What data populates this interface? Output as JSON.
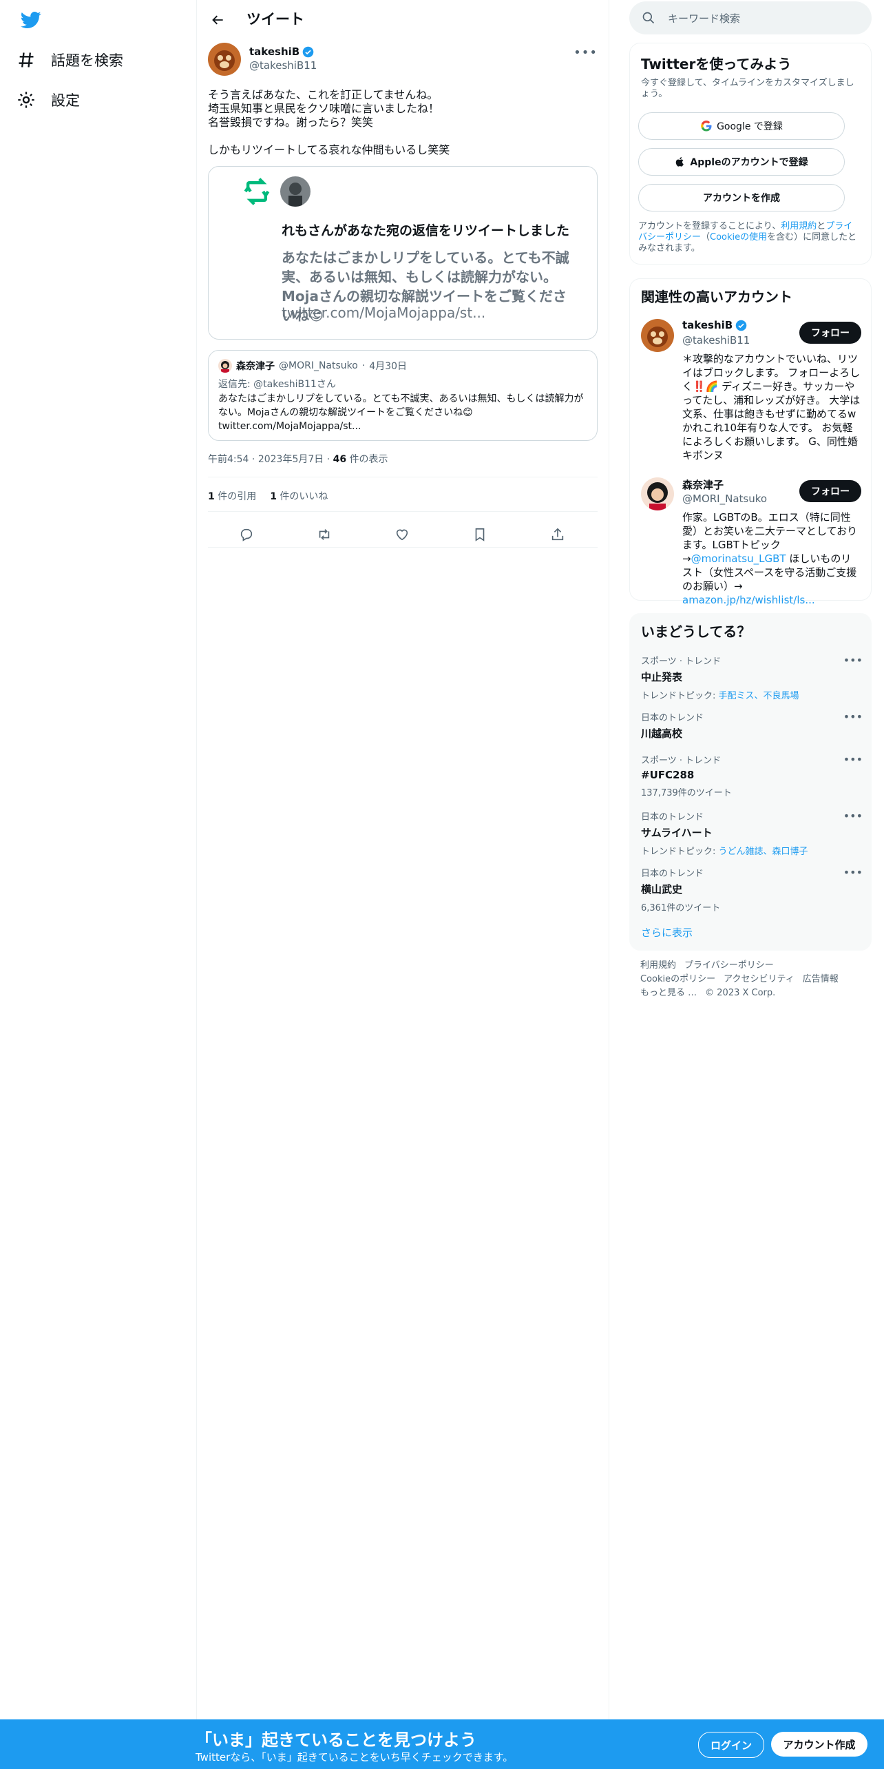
{
  "nav": {
    "explore_label": "話題を検索",
    "settings_label": "設定"
  },
  "header": {
    "title": "ツイート"
  },
  "tweet": {
    "author_name": "takeshiB",
    "author_handle": "@takeshiB11",
    "text": "そう言えばあなた、これを訂正してませんね。\n埼玉県知事と県民をクソ味噌に言いましたね！\n名誉毀損ですね。謝ったら？笑笑\n\nしかもリツイートしてる哀れな仲間もいるし笑笑",
    "card": {
      "heading": "れもさんがあなた宛の返信をリツイートしました",
      "body": "あなたはごまかしリプをしている。とても不誠実、あるいは無知、もしくは読解力がない。Mojaさんの親切な解説ツイートをご覧くださいね😊",
      "link": "twitter.com/MojaMojappa/st..."
    },
    "quote": {
      "name": "森奈津子",
      "handle": "@MORI_Natsuko",
      "dot": "·",
      "date": "4月30日",
      "reply_to": "返信先: @takeshiB11さん",
      "text": "あなたはごまかしリプをしている。とても不誠実、あるいは無知、もしくは読解力がない。Mojaさんの親切な解説ツイートをご覧くださいね😊\ntwitter.com/MojaMojappa/st..."
    },
    "meta": {
      "time": "午前4:54",
      "date": "2023年5月7日",
      "views_count": "46",
      "views_label": "件の表示"
    },
    "stats": {
      "quotes_count": "1",
      "quotes_label": "件の引用",
      "likes_count": "1",
      "likes_label": "件のいいね"
    }
  },
  "search": {
    "placeholder": "キーワード検索"
  },
  "signup": {
    "title": "Twitterを使ってみよう",
    "subtitle": "今すぐ登録して、タイムラインをカスタマイズしましょう。",
    "google_label": "Google で登録",
    "apple_label": "Appleのアカウントで登録",
    "create_label": "アカウントを作成",
    "terms_prefix": "アカウントを登録することにより、",
    "terms_link1": "利用規約",
    "terms_and": "と",
    "terms_link2": "プライバシーポリシー",
    "terms_paren_open": "（",
    "terms_link3": "Cookieの使用",
    "terms_suffix": "を含む）に同意したとみなされます。"
  },
  "related": {
    "title": "関連性の高いアカウント",
    "accounts": [
      {
        "name": "takeshiB",
        "handle": "@takeshiB11",
        "follow_label": "フォロー",
        "bio": "＊攻撃的なアカウントでいいね、リツイはブロックします。 フォローよろしく‼️🌈 ディズニー好き。サッカーやってたし、浦和レッズが好き。 大学は文系、仕事は飽きもせずに勤めてるw かれこれ10年有りな人です。 お気軽によろしくお願いします。 G、同性婚キボンヌ"
      },
      {
        "name": "森奈津子",
        "handle": "@MORI_Natsuko",
        "follow_label": "フォロー",
        "bio_prefix": "作家。LGBTのB。エロス（特に同性愛）とお笑いを二大テーマとしております。LGBTトピック→",
        "bio_link1": "@morinatsu_LGBT",
        "bio_middle": " ほしいものリスト（女性スペースを守る活動ご支援のお願い）→ ",
        "bio_link2": "amazon.jp/hz/wishlist/ls..."
      }
    ]
  },
  "trends": {
    "title": "いまどうしてる？",
    "items": [
      {
        "meta": "スポーツ · トレンド",
        "name": "中止発表",
        "sub_label": "トレンドトピック: ",
        "sub_links": "手配ミス、不良馬場"
      },
      {
        "meta": "日本のトレンド",
        "name": "川越高校"
      },
      {
        "meta": "スポーツ · トレンド",
        "name": "#UFC288",
        "count": "137,739件のツイート"
      },
      {
        "meta": "日本のトレンド",
        "name": "サムライハート",
        "sub_label": "トレンドトピック: ",
        "sub_links": "うどん雑誌、森口博子"
      },
      {
        "meta": "日本のトレンド",
        "name": "横山武史",
        "count": "6,361件のツイート"
      }
    ],
    "show_more": "さらに表示"
  },
  "footer": {
    "links": [
      "利用規約",
      "プライバシーポリシー",
      "Cookieのポリシー",
      "アクセシビリティ",
      "広告情報",
      "もっと見る …"
    ],
    "copyright": "© 2023 X Corp."
  },
  "bottom_bar": {
    "title": "「いま」起きていることを見つけよう",
    "subtitle": "Twitterなら、「いま」起きていることをいち早くチェックできます。",
    "login_label": "ログイン",
    "signup_label": "アカウント作成"
  },
  "colors": {
    "accent": "#1d9bf0",
    "retweet_green": "#00ba7c",
    "text": "#0f1419",
    "muted": "#536471"
  },
  "icons": [
    "twitter-logo-icon",
    "hashtag-icon",
    "gear-icon",
    "back-arrow-icon",
    "verified-badge-icon",
    "more-icon",
    "retweet-icon",
    "reply-icon",
    "like-icon",
    "bookmark-icon",
    "share-icon",
    "search-icon",
    "google-icon",
    "apple-icon"
  ]
}
